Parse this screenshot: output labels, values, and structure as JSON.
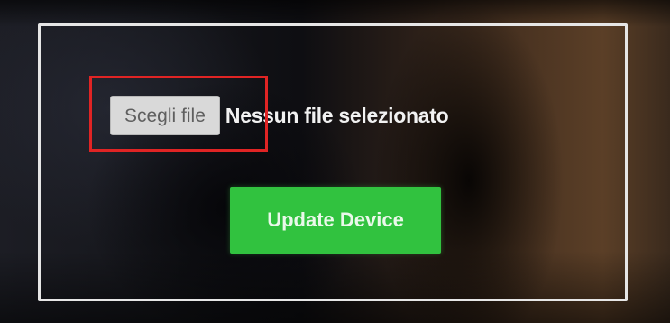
{
  "upload_form": {
    "choose_file_label": "Scegli file",
    "file_status_text": "Nessun file selezionato",
    "update_button_label": "Update Device"
  },
  "colors": {
    "update_button": "#31c23f",
    "highlight_box": "#e02424",
    "frame_border": "#e6e6e6"
  }
}
